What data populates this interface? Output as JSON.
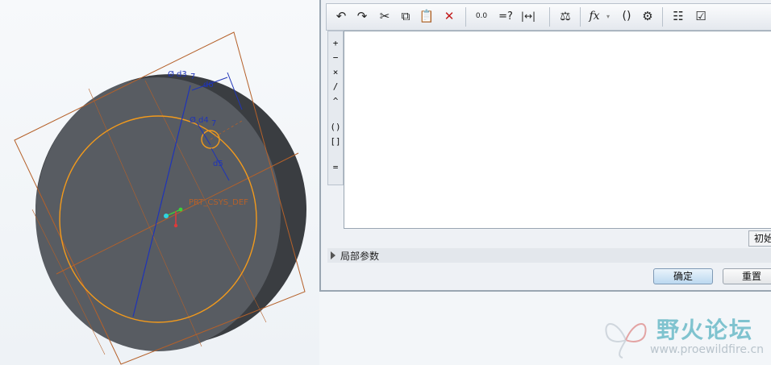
{
  "model": {
    "dimension_labels": [
      "Ø d3",
      "7",
      "d6",
      "Ø d4",
      "7",
      "d5"
    ],
    "csys_label": "PRT_CSYS_DEF",
    "colors": {
      "face": "#585c62",
      "side": "#3c3f43",
      "sketch_circle": "#f29a1c",
      "datum_planes": "#b5612a",
      "dimension": "#1f34b8",
      "csys": "#b5612a"
    }
  },
  "toolbar": {
    "items": [
      {
        "name": "undo-icon",
        "glyph": "↶"
      },
      {
        "name": "redo-icon",
        "glyph": "↷"
      },
      {
        "name": "cut-icon",
        "glyph": "✂"
      },
      {
        "name": "copy-icon",
        "glyph": "⧉"
      },
      {
        "name": "paste-icon",
        "glyph": "📋"
      },
      {
        "name": "delete-icon",
        "glyph": "✕"
      },
      {
        "name": "dimension-value-icon",
        "glyph": "0.0"
      },
      {
        "name": "verify-icon",
        "glyph": "=?"
      },
      {
        "name": "measure-icon",
        "glyph": "|↔|"
      },
      {
        "name": "evaluate-icon",
        "glyph": "⚖"
      },
      {
        "name": "function-icon",
        "glyph": "fx"
      },
      {
        "name": "brackets-icon",
        "glyph": "()"
      },
      {
        "name": "parameters-icon",
        "glyph": "⚙"
      },
      {
        "name": "sort-icon",
        "glyph": "☷"
      },
      {
        "name": "check-icon",
        "glyph": "☑"
      }
    ]
  },
  "side_operators": [
    "+",
    "−",
    "×",
    "/",
    "^",
    "()",
    "[]",
    "="
  ],
  "editor": {
    "content": ""
  },
  "init_button": "初始",
  "local_params_label": "局部参数",
  "buttons": {
    "ok": "确定",
    "reset": "重置"
  },
  "watermark": {
    "title": "野火论坛",
    "url": "www.proewildfire.cn"
  }
}
